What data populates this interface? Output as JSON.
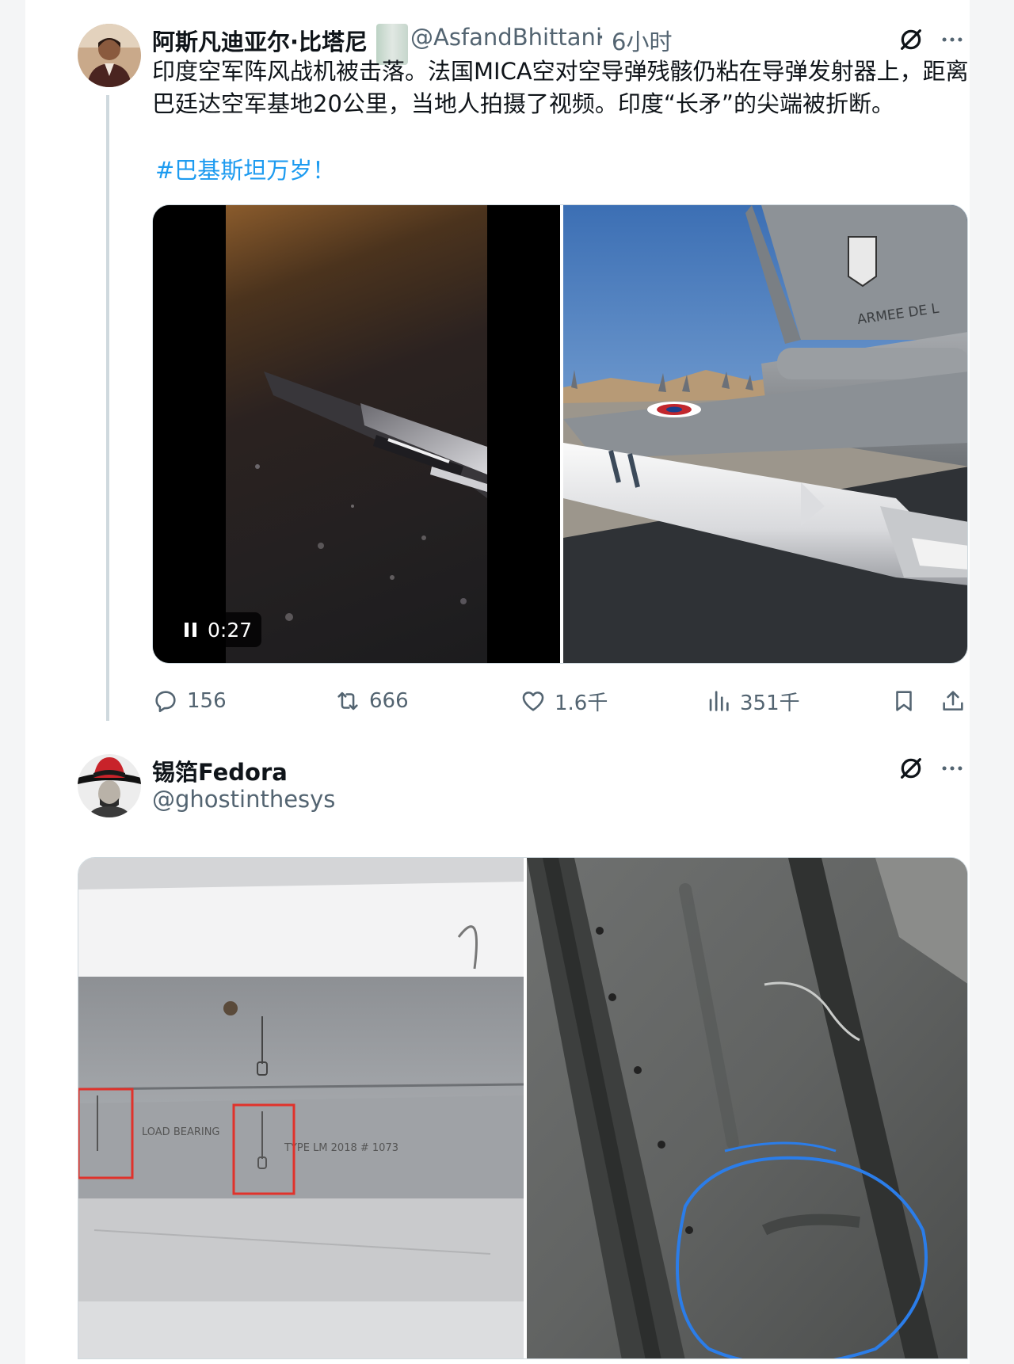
{
  "tweet1": {
    "author_name": "阿斯凡迪亚尔·比塔尼",
    "handle": "@AsfandBhittani",
    "separator": "·",
    "time": "6小时",
    "text": "印度空军阵风战机被击落。法国MICA空对空导弹残骸仍粘在导弹发射器上，距离巴廷达空军基地20公里，当地人拍摄了视频。印度“长矛”的尖端被折断。",
    "hashtag": "#巴基斯坦万岁！",
    "video_duration": "0:27",
    "photo_tail_text": "ARMEE DE L",
    "stats": {
      "replies": "156",
      "reposts": "666",
      "likes": "1.6千",
      "views": "351千"
    }
  },
  "tweet2": {
    "author_name": "锡箔Fedora",
    "handle": "@ghostinthesys",
    "label_text_1": "LOAD BEARING",
    "label_text_2": "TYPE LM 2018 # 1073"
  },
  "icons": {
    "grok": "grok-slash-icon",
    "more": "more-dots-icon",
    "reply": "reply-bubble-icon",
    "repost": "repost-icon",
    "like": "heart-icon",
    "views": "views-bars-icon",
    "bookmark": "bookmark-icon",
    "share": "share-upload-icon",
    "pause": "pause-icon"
  },
  "colors": {
    "link": "#1d9bf0",
    "secondary_text": "#536471",
    "primary_text": "#0f1419",
    "highlight_box": "#e0322b",
    "annotation_circle": "#2b7de9"
  }
}
